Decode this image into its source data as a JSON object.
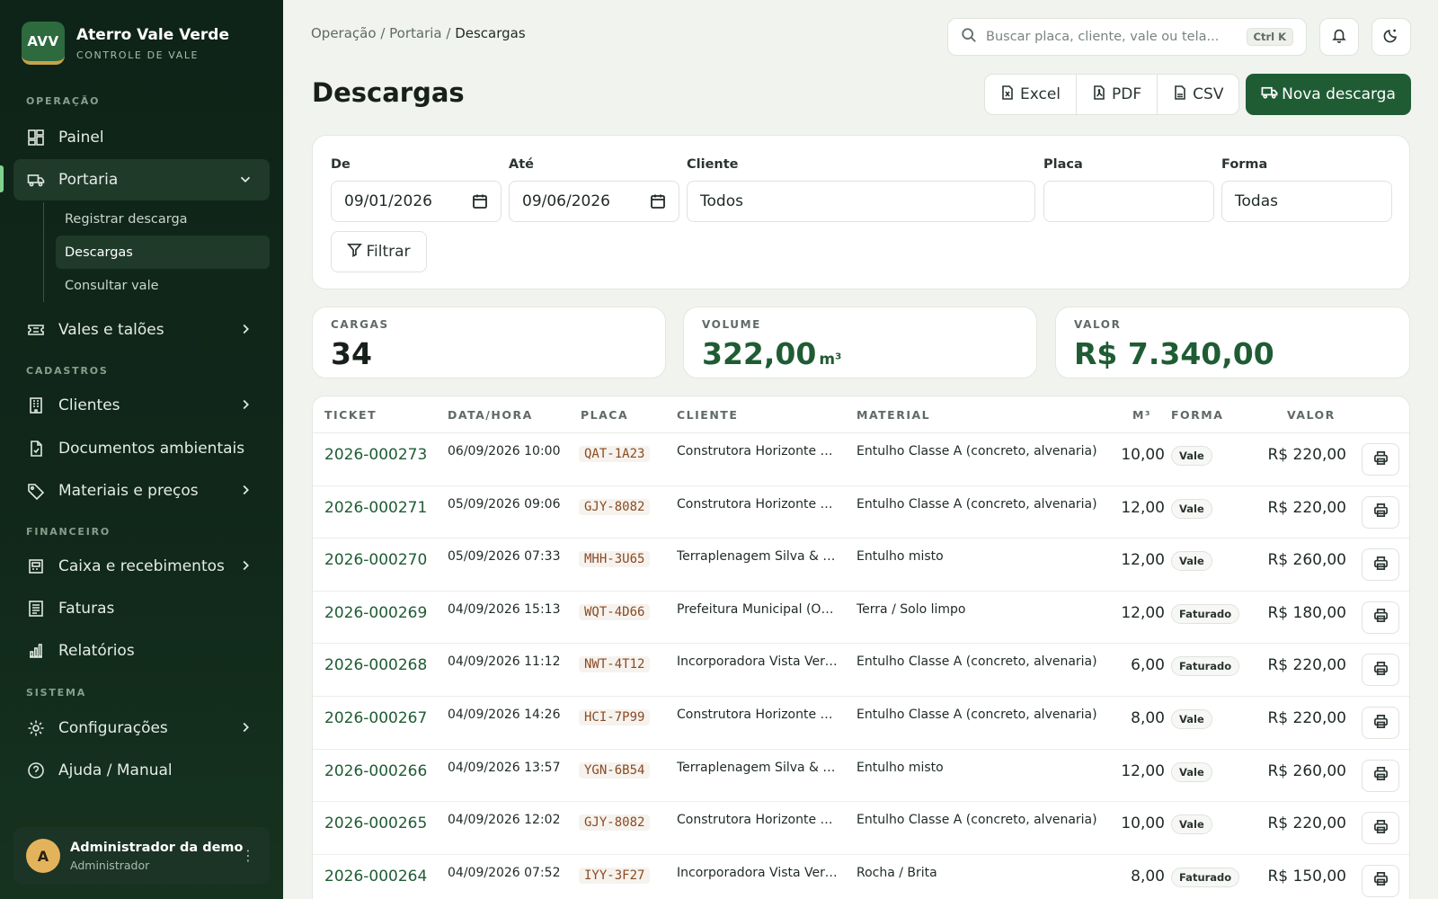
{
  "brand": {
    "logo": "AVV",
    "name": "Aterro Vale Verde",
    "subtitle": "CONTROLE DE VALE"
  },
  "sidebar": {
    "sections": {
      "operacao": "OPERAÇÃO",
      "cadastros": "CADASTROS",
      "financeiro": "FINANCEIRO",
      "sistema": "SISTEMA"
    },
    "items": {
      "painel": "Painel",
      "portaria": "Portaria",
      "vales": "Vales e talões",
      "clientes": "Clientes",
      "documentos": "Documentos ambientais",
      "materiais": "Materiais e preços",
      "caixa": "Caixa e recebimentos",
      "faturas": "Faturas",
      "relatorios": "Relatórios",
      "configuracoes": "Configurações",
      "ajuda": "Ajuda / Manual"
    },
    "portaria_sub": [
      "Registrar descarga",
      "Descargas",
      "Consultar vale"
    ],
    "active_sub": "Descargas"
  },
  "user": {
    "initial": "A",
    "name": "Administrador da demo",
    "role": "Administrador"
  },
  "breadcrumb": {
    "part1": "Operação",
    "part2": "Portaria",
    "current": "Descargas",
    "sep": " / "
  },
  "search": {
    "placeholder": "Buscar placa, cliente, vale ou tela...",
    "shortcut": "Ctrl K"
  },
  "page": {
    "title": "Descargas"
  },
  "actions": {
    "excel": "Excel",
    "pdf": "PDF",
    "csv": "CSV",
    "new": "Nova descarga"
  },
  "filters": {
    "de_label": "De",
    "de_value": "09/01/2026",
    "ate_label": "Até",
    "ate_value": "09/06/2026",
    "cliente_label": "Cliente",
    "cliente_value": "Todos",
    "placa_label": "Placa",
    "placa_value": "",
    "forma_label": "Forma",
    "forma_value": "Todas",
    "filter_button": "Filtrar"
  },
  "stats": {
    "cargas_label": "CARGAS",
    "cargas_value": "34",
    "volume_label": "VOLUME",
    "volume_value": "322,00",
    "volume_unit": "m³",
    "valor_label": "VALOR",
    "valor_value": "R$ 7.340,00"
  },
  "table": {
    "headers": {
      "ticket": "TICKET",
      "datahora": "DATA/HORA",
      "placa": "PLACA",
      "cliente": "CLIENTE",
      "material": "MATERIAL",
      "m3": "M³",
      "forma": "FORMA",
      "valor": "VALOR"
    },
    "rows": [
      {
        "ticket": "2026-000273",
        "datetime": "06/09/2026 10:00",
        "plate": "QAT-1A23",
        "client": "Construtora Horizonte Ltda",
        "material": "Entulho Classe A (concreto, alvenaria)",
        "m3": "10,00",
        "forma": "Vale",
        "valor": "R$ 220,00"
      },
      {
        "ticket": "2026-000271",
        "datetime": "05/09/2026 09:06",
        "plate": "GJY-8082",
        "client": "Construtora Horizonte Ltda",
        "material": "Entulho Classe A (concreto, alvenaria)",
        "m3": "12,00",
        "forma": "Vale",
        "valor": "R$ 220,00"
      },
      {
        "ticket": "2026-000270",
        "datetime": "05/09/2026 07:33",
        "plate": "MHH-3U65",
        "client": "Terraplenagem Silva & Filhos",
        "material": "Entulho misto",
        "m3": "12,00",
        "forma": "Vale",
        "valor": "R$ 260,00"
      },
      {
        "ticket": "2026-000269",
        "datetime": "04/09/2026 15:13",
        "plate": "WQT-4D66",
        "client": "Prefeitura Municipal (Obras)",
        "material": "Terra / Solo limpo",
        "m3": "12,00",
        "forma": "Faturado",
        "valor": "R$ 180,00"
      },
      {
        "ticket": "2026-000268",
        "datetime": "04/09/2026 11:12",
        "plate": "NWT-4T12",
        "client": "Incorporadora Vista Verde",
        "material": "Entulho Classe A (concreto, alvenaria)",
        "m3": "6,00",
        "forma": "Faturado",
        "valor": "R$ 220,00"
      },
      {
        "ticket": "2026-000267",
        "datetime": "04/09/2026 14:26",
        "plate": "HCI-7P99",
        "client": "Construtora Horizonte Ltda",
        "material": "Entulho Classe A (concreto, alvenaria)",
        "m3": "8,00",
        "forma": "Vale",
        "valor": "R$ 220,00"
      },
      {
        "ticket": "2026-000266",
        "datetime": "04/09/2026 13:57",
        "plate": "YGN-6B54",
        "client": "Terraplenagem Silva & Filhos",
        "material": "Entulho misto",
        "m3": "12,00",
        "forma": "Vale",
        "valor": "R$ 260,00"
      },
      {
        "ticket": "2026-000265",
        "datetime": "04/09/2026 12:02",
        "plate": "GJY-8082",
        "client": "Construtora Horizonte Ltda",
        "material": "Entulho Classe A (concreto, alvenaria)",
        "m3": "10,00",
        "forma": "Vale",
        "valor": "R$ 220,00"
      },
      {
        "ticket": "2026-000264",
        "datetime": "04/09/2026 07:52",
        "plate": "IYY-3F27",
        "client": "Incorporadora Vista Verde",
        "material": "Rocha / Brita",
        "m3": "8,00",
        "forma": "Faturado",
        "valor": "R$ 150,00"
      }
    ]
  },
  "colors": {
    "sidebar_bg": "#0f2418",
    "accent": "#1f5c34",
    "active_bar": "#7fd38e",
    "plate_text": "#8a4a24"
  },
  "icons": [
    "dashboard-icon",
    "truck-icon",
    "ticket-icon",
    "building-icon",
    "document-icon",
    "tag-icon",
    "cash-register-icon",
    "invoice-icon",
    "chart-icon",
    "gear-icon",
    "help-icon",
    "search-icon",
    "bell-icon",
    "moon-icon",
    "excel-icon",
    "pdf-icon",
    "csv-icon",
    "calendar-icon",
    "filter-icon",
    "printer-icon"
  ]
}
